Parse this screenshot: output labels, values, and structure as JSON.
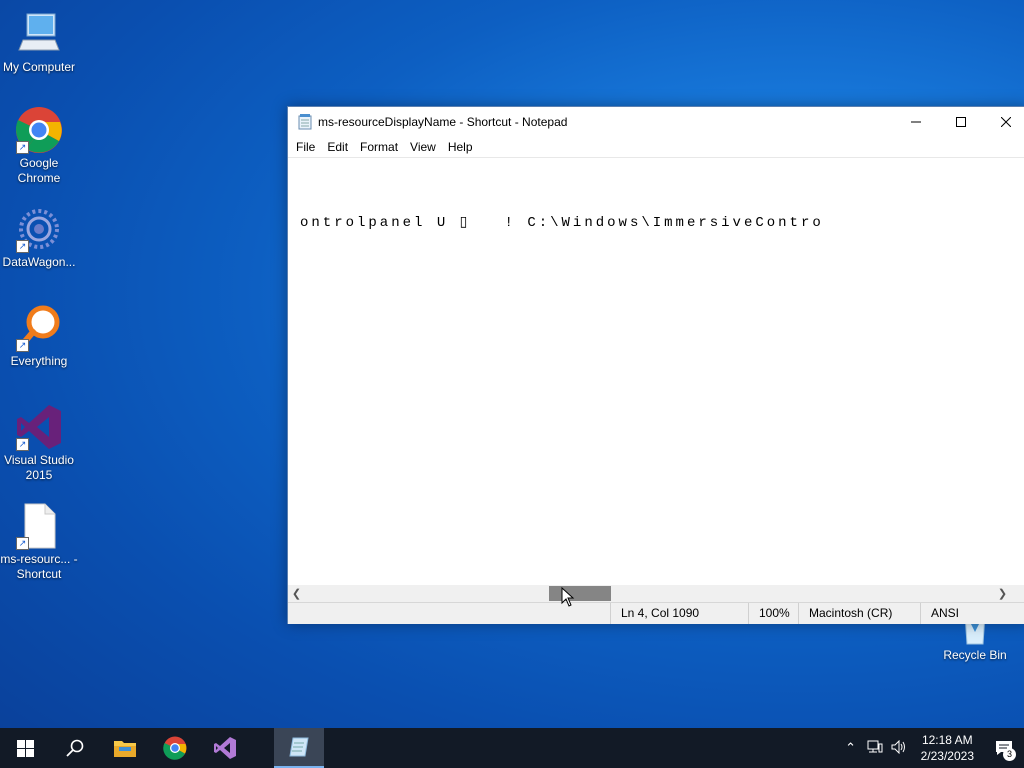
{
  "desktop": {
    "icons": [
      {
        "label": "My Computer"
      },
      {
        "label": "Google Chrome"
      },
      {
        "label": "DataWagon..."
      },
      {
        "label": "Everything"
      },
      {
        "label": "Visual Studio 2015"
      },
      {
        "label": "ms-resourc... - Shortcut"
      },
      {
        "label": "Recycle Bin"
      }
    ]
  },
  "notepad": {
    "title": "ms-resourceDisplayName - Shortcut - Notepad",
    "menu": [
      "File",
      "Edit",
      "Format",
      "View",
      "Help"
    ],
    "content_line": "ontrolpanel U ▯   ! C:\\Windows\\ImmersiveContro",
    "status": {
      "position": "Ln 4, Col 1090",
      "zoom": "100%",
      "line_ending": "Macintosh (CR)",
      "encoding": "ANSI"
    },
    "scroll_fraction": 0.38
  },
  "taskbar": {
    "clock_time": "12:18 AM",
    "clock_date": "2/23/2023",
    "notification_count": "3"
  }
}
